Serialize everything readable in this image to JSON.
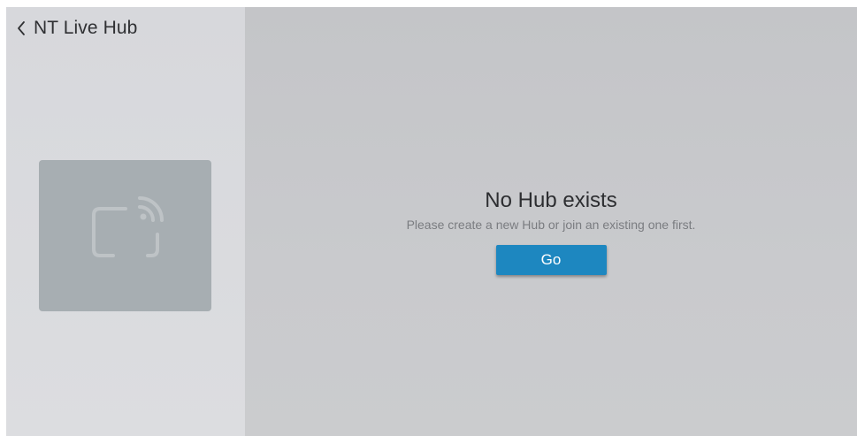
{
  "header": {
    "back_icon": "chevron-left-icon",
    "title": "NT Live Hub"
  },
  "sidebar": {
    "device_icon": "cast-screen-icon"
  },
  "empty_state": {
    "title": "No Hub exists",
    "subtitle": "Please create a new Hub or join an existing one first.",
    "button_label": "Go"
  },
  "colors": {
    "sidebar_bg": "#d9dade",
    "main_bg": "#c7c8cb",
    "card_bg": "#a7aeb2",
    "accent": "#1d87c0"
  }
}
